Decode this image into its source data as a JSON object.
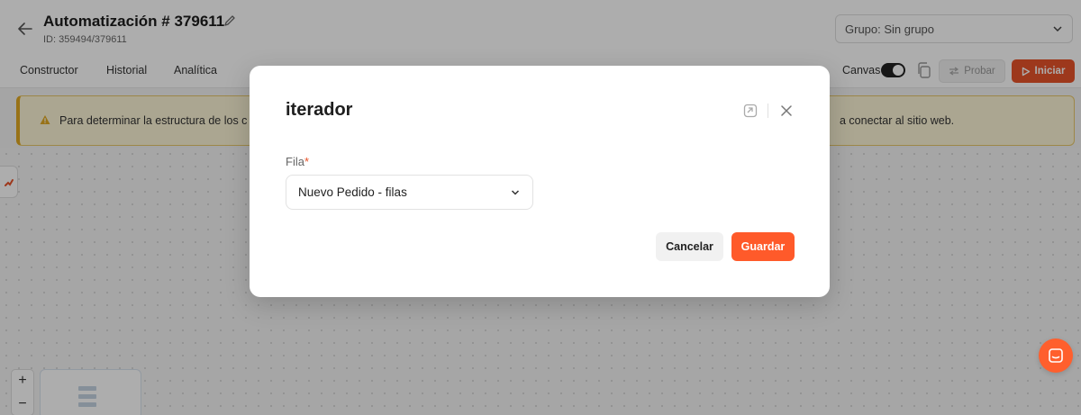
{
  "header": {
    "title": "Automatización # 379611",
    "id_text": "ID: 359494/379611",
    "group_select_value": "Grupo: Sin grupo"
  },
  "tabs": [
    {
      "label": "Constructor"
    },
    {
      "label": "Historial"
    },
    {
      "label": "Analítica"
    }
  ],
  "toolbar": {
    "canvas_label": "Canvas",
    "canvas_on": true,
    "probar_label": "Probar",
    "iniciar_label": "Iniciar"
  },
  "warning": {
    "text_left": "Para determinar la estructura de los c",
    "text_right": "a conectar al sitio web."
  },
  "modal": {
    "title": "iterador",
    "field_label": "Fila",
    "field_required_mark": "*",
    "select_value": "Nuevo Pedido - filas",
    "cancel_label": "Cancelar",
    "save_label": "Guardar"
  },
  "zoom": {
    "in_label": "+",
    "out_label": "−"
  },
  "colors": {
    "accent": "#ff5a2a",
    "iniciar": "#e8532a",
    "warning_bg": "#fdf5d6",
    "warning_border": "#e0a922"
  },
  "icons": {
    "back": "arrow-left-icon",
    "edit": "pencil-icon",
    "chevron": "chevron-down-icon",
    "copy": "copy-icon",
    "probar": "swap-icon",
    "iniciar": "play-icon",
    "warning": "warning-triangle-icon",
    "link": "link-icon",
    "close": "close-icon",
    "chat": "chat-icon"
  }
}
